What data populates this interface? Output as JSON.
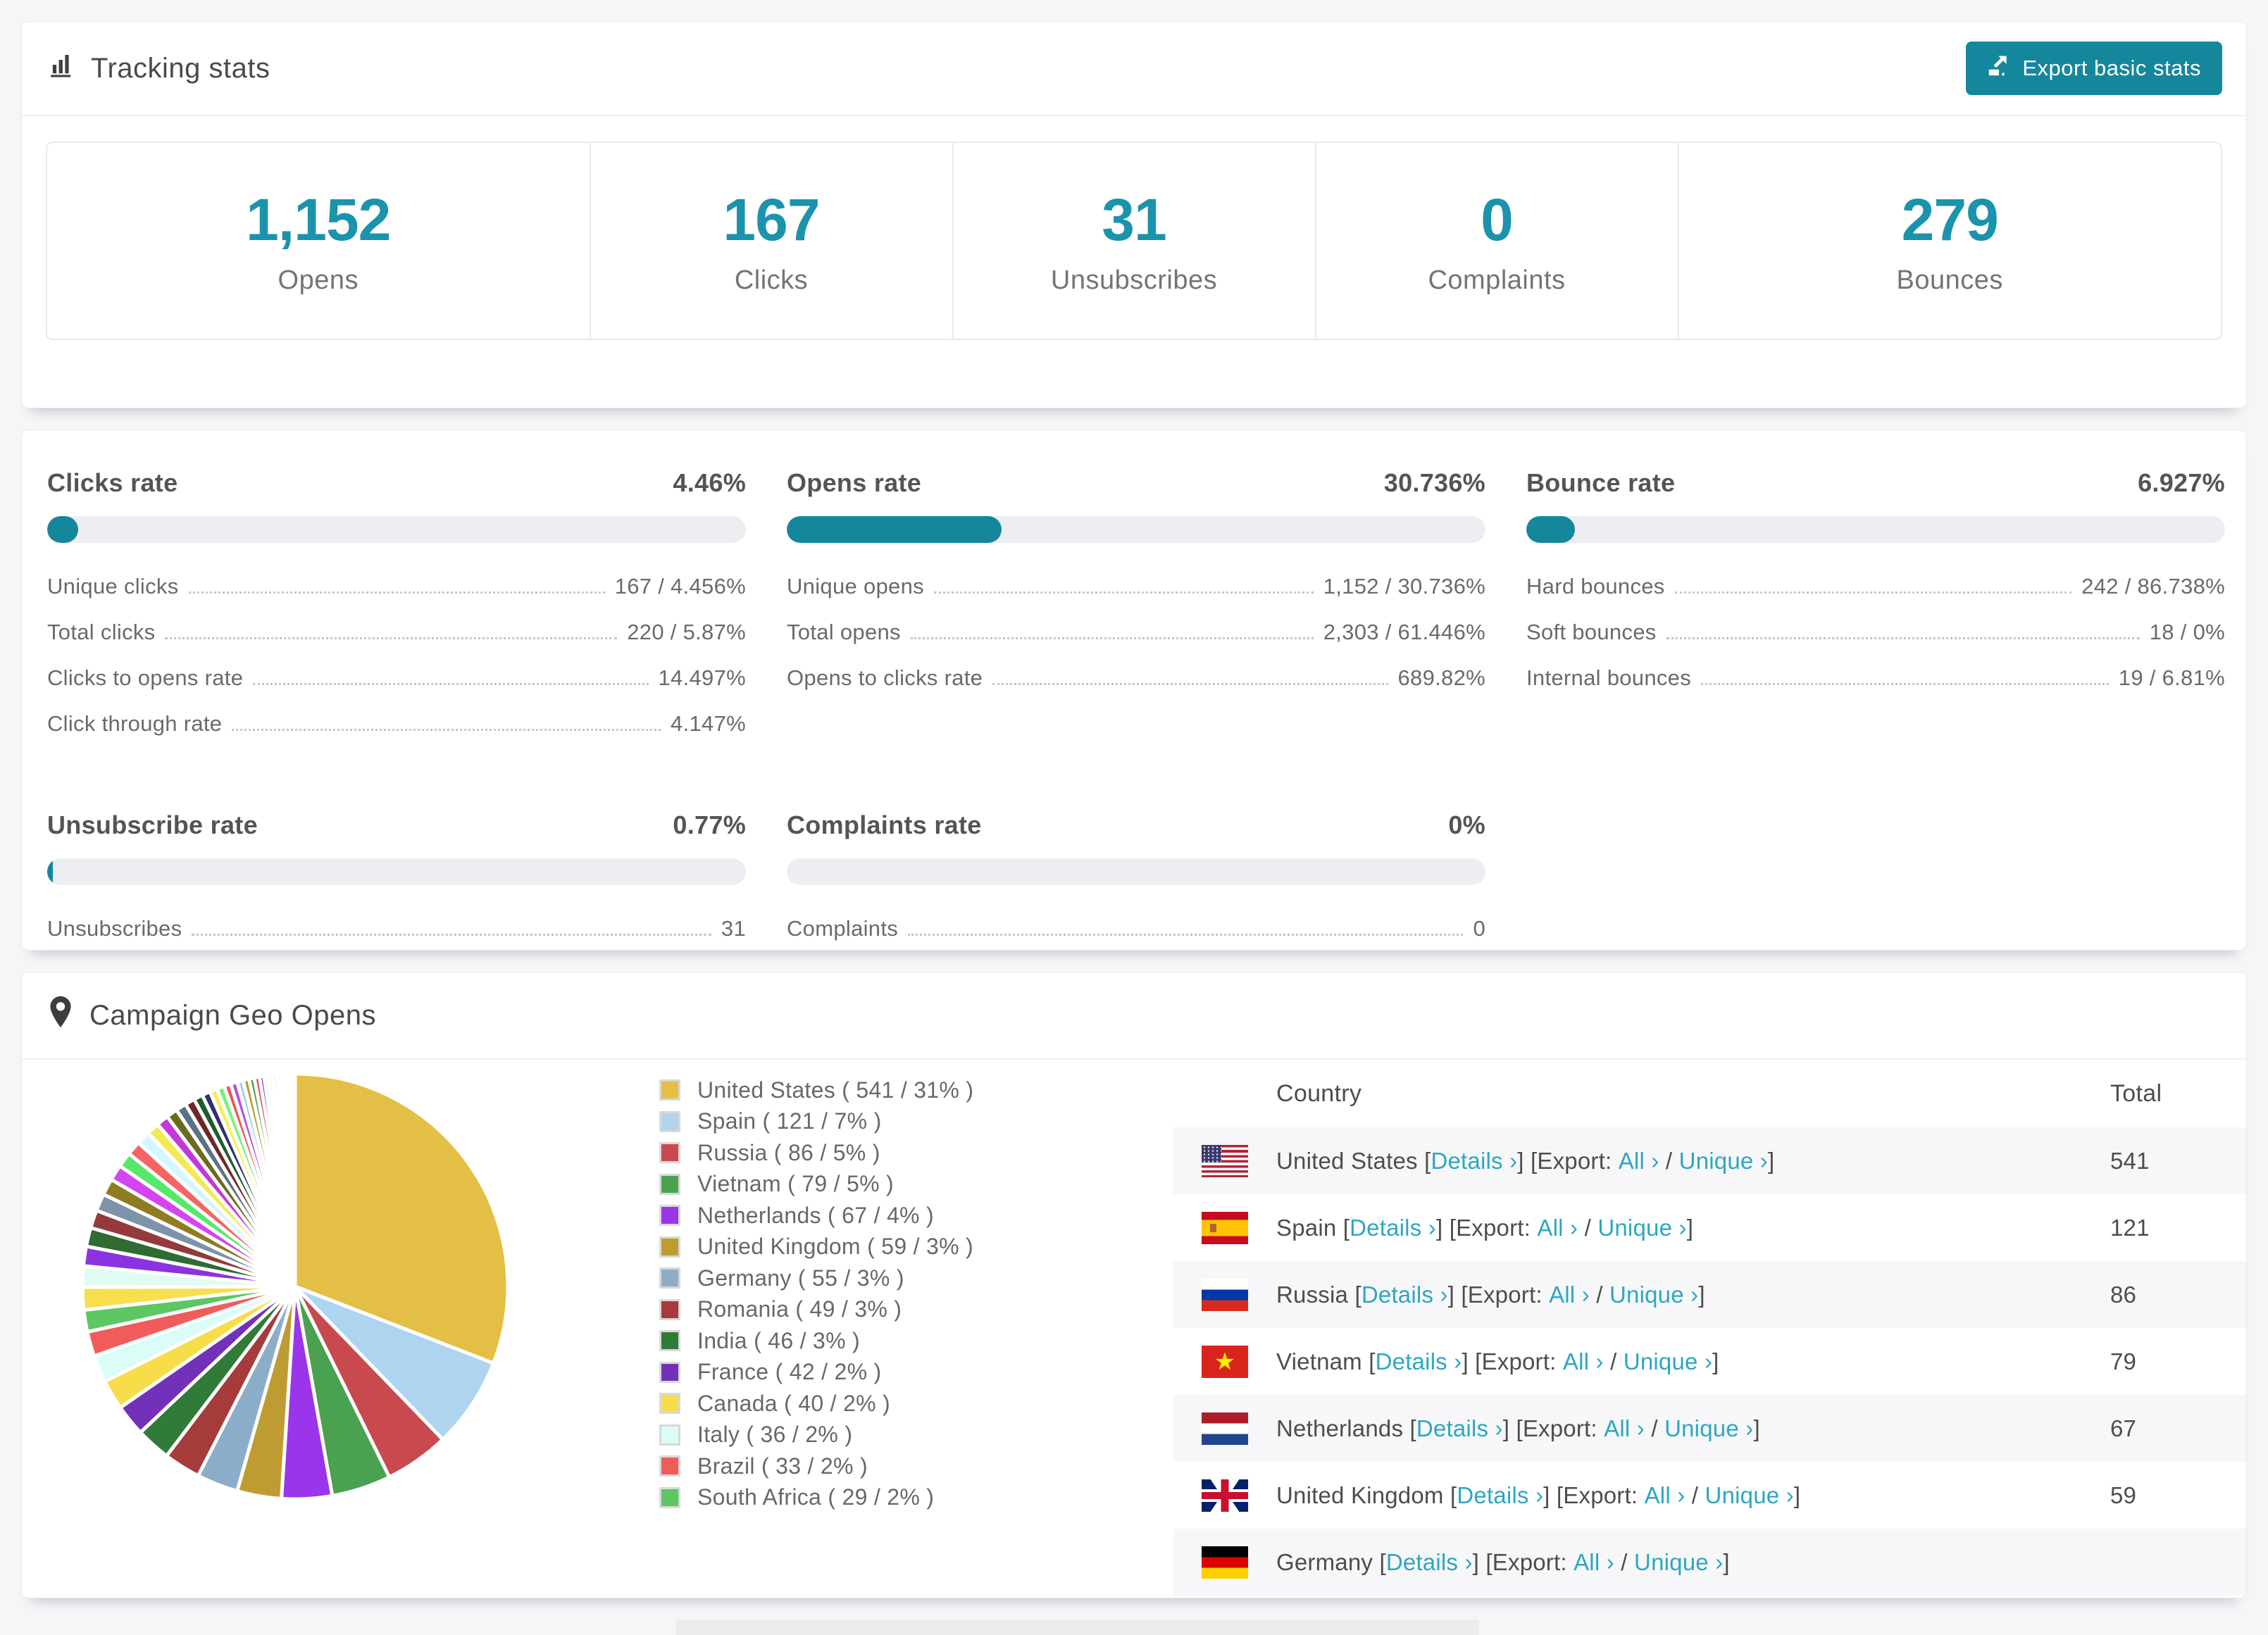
{
  "accent": {
    "button": "#15879c",
    "number": "#1b93ac",
    "link": "#2da7c0",
    "bar_fill": "#15879c"
  },
  "tracking": {
    "title": "Tracking stats",
    "export_button": "Export basic stats",
    "stats": [
      {
        "value": "1,152",
        "label": "Opens"
      },
      {
        "value": "167",
        "label": "Clicks"
      },
      {
        "value": "31",
        "label": "Unsubscribes"
      },
      {
        "value": "0",
        "label": "Complaints"
      },
      {
        "value": "279",
        "label": "Bounces"
      }
    ]
  },
  "rates": {
    "sections": [
      {
        "title": "Clicks rate",
        "value": "4.46%",
        "bar_percent": 4.46,
        "rows": [
          [
            "Unique clicks",
            "167 / 4.456%"
          ],
          [
            "Total clicks",
            "220 / 5.87%"
          ],
          [
            "Clicks to opens rate",
            "14.497%"
          ],
          [
            "Click through rate",
            "4.147%"
          ]
        ]
      },
      {
        "title": "Opens rate",
        "value": "30.736%",
        "bar_percent": 30.736,
        "rows": [
          [
            "Unique opens",
            "1,152 / 30.736%"
          ],
          [
            "Total opens",
            "2,303 / 61.446%"
          ],
          [
            "Opens to clicks rate",
            "689.82%"
          ]
        ]
      },
      {
        "title": "Bounce rate",
        "value": "6.927%",
        "bar_percent": 6.927,
        "rows": [
          [
            "Hard bounces",
            "242 / 86.738%"
          ],
          [
            "Soft bounces",
            "18 / 0%"
          ],
          [
            "Internal bounces",
            "19 / 6.81%"
          ]
        ]
      },
      {
        "title": "Unsubscribe rate",
        "value": "0.77%",
        "bar_percent": 0.77,
        "rows": [
          [
            "Unsubscribes",
            "31"
          ]
        ]
      },
      {
        "title": "Complaints rate",
        "value": "0%",
        "bar_percent": 0,
        "rows": [
          [
            "Complaints",
            "0"
          ]
        ]
      }
    ]
  },
  "geo": {
    "title": "Campaign Geo Opens",
    "chart_data": {
      "type": "pie",
      "legend_position": "right",
      "series": [
        {
          "name": "United States",
          "value": 541,
          "percent": 31,
          "color": "#e3bf45"
        },
        {
          "name": "Spain",
          "value": 121,
          "percent": 7,
          "color": "#aed4f0"
        },
        {
          "name": "Russia",
          "value": 86,
          "percent": 5,
          "color": "#c84a4e"
        },
        {
          "name": "Vietnam",
          "value": 79,
          "percent": 5,
          "color": "#4aa14f"
        },
        {
          "name": "Netherlands",
          "value": 67,
          "percent": 4,
          "color": "#9a35ea"
        },
        {
          "name": "United Kingdom",
          "value": 59,
          "percent": 3,
          "color": "#bf9c31"
        },
        {
          "name": "Germany",
          "value": 55,
          "percent": 3,
          "color": "#8cadc9"
        },
        {
          "name": "Romania",
          "value": 49,
          "percent": 3,
          "color": "#a53b3b"
        },
        {
          "name": "India",
          "value": 46,
          "percent": 3,
          "color": "#317b38"
        },
        {
          "name": "France",
          "value": 42,
          "percent": 2,
          "color": "#7231b8"
        },
        {
          "name": "Canada",
          "value": 40,
          "percent": 2,
          "color": "#f8dd4a"
        },
        {
          "name": "Italy",
          "value": 36,
          "percent": 2,
          "color": "#dafdf8"
        },
        {
          "name": "Brazil",
          "value": 33,
          "percent": 2,
          "color": "#f05c5c"
        },
        {
          "name": "South Africa",
          "value": 29,
          "percent": 2,
          "color": "#5cc763"
        }
      ],
      "others": {
        "values": [
          30,
          28,
          26,
          25,
          24,
          23,
          22,
          21,
          20,
          19,
          18,
          17,
          16,
          15,
          14,
          13,
          12,
          11,
          10,
          10,
          9,
          9,
          8,
          8,
          7,
          7,
          6,
          6,
          5,
          5,
          4,
          4,
          3,
          3,
          2,
          2,
          2,
          1,
          1,
          1,
          1,
          1
        ],
        "colors": [
          "#f7df4d",
          "#e0fbf4",
          "#8b33e0",
          "#2f6b33",
          "#953a3a",
          "#7d93a8",
          "#8f7c22",
          "#d544ee",
          "#57e86b",
          "#f56464",
          "#d6f6ff",
          "#f2ea52",
          "#c238d8",
          "#6b6b1f",
          "#5a7284",
          "#6e2727",
          "#1e5c2e",
          "#30306e",
          "#f6f052",
          "#7aef7f",
          "#ef5252",
          "#b055e0",
          "#a5d2f0",
          "#c19a30",
          "#3da04b",
          "#dd4f4f",
          "#7a35c8",
          "#d8fbff",
          "#ecb830",
          "#88b8d8",
          "#a03838",
          "#2e7d3a",
          "#6930b0",
          "#f0d840",
          "#50c860",
          "#e05858",
          "#c86be0",
          "#9adcf0",
          "#d4b040",
          "#64b868",
          "#e86868",
          "#9a50d8"
        ]
      }
    },
    "table": {
      "headers": [
        "Country",
        "Total"
      ],
      "link_labels": {
        "details": "Details ›",
        "export": "Export:",
        "all": "All ›",
        "unique": "Unique ›"
      },
      "rows": [
        {
          "country": "United States",
          "flag": "us",
          "total": "541"
        },
        {
          "country": "Spain",
          "flag": "es",
          "total": "121"
        },
        {
          "country": "Russia",
          "flag": "ru",
          "total": "86"
        },
        {
          "country": "Vietnam",
          "flag": "vn",
          "total": "79"
        },
        {
          "country": "Netherlands",
          "flag": "nl",
          "total": "67"
        },
        {
          "country": "United Kingdom",
          "flag": "gb",
          "total": "59"
        },
        {
          "country": "Germany",
          "flag": "de",
          "total": ""
        }
      ]
    }
  }
}
